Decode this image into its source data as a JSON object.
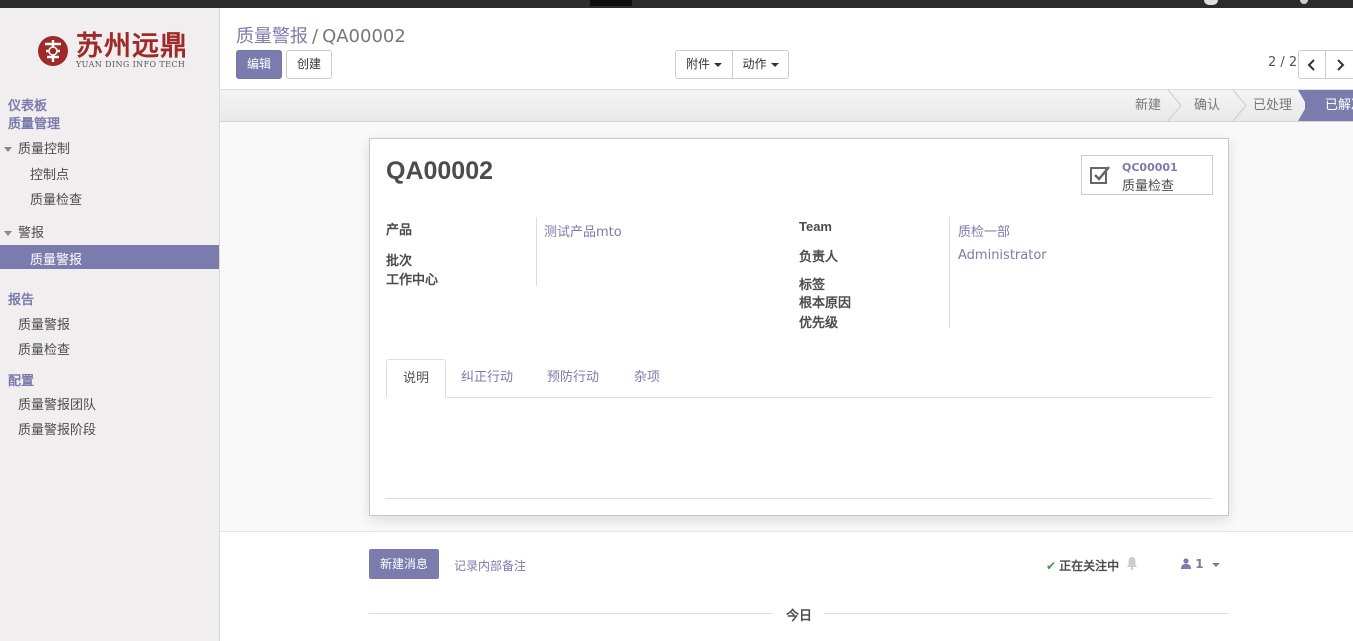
{
  "brand": {
    "name_cn": "苏州远鼎",
    "name_en": "YUAN DING INFO TECH"
  },
  "sidebar": {
    "dashboard": "仪表板",
    "quality_mgmt": "质量管理",
    "group_quality_control": "质量控制",
    "item_control_points": "控制点",
    "item_quality_checks": "质量检查",
    "group_alerts": "警报",
    "item_quality_alerts_active": "质量警报",
    "section_reports": "报告",
    "report_quality_alerts": "质量警报",
    "report_quality_checks": "质量检查",
    "section_config": "配置",
    "config_alert_teams": "质量警报团队",
    "config_alert_stages": "质量警报阶段"
  },
  "breadcrumb": {
    "parent": "质量警报",
    "separator": "/",
    "current": "QA00002"
  },
  "buttons": {
    "edit": "编辑",
    "create": "创建",
    "attachment": "附件",
    "action": "动作"
  },
  "pager": {
    "text": "2 / 2",
    "prev_icon": "chevron-left-icon",
    "next_icon": "chevron-right-icon"
  },
  "statusbar": {
    "stages": [
      "新建",
      "确认",
      "已处理",
      "已解决"
    ],
    "active_index": 3
  },
  "record": {
    "name": "QA00002",
    "smart_button": {
      "value": "QC00001",
      "label": "质量检查",
      "icon": "checkbox-icon"
    },
    "labels": {
      "product": "产品",
      "lot": "批次",
      "workcenter": "工作中心",
      "team": "Team",
      "responsible": "负责人",
      "tags": "标签",
      "root_cause": "根本原因",
      "priority": "优先级"
    },
    "values": {
      "product": "测试产品mto",
      "team": "质检一部",
      "responsible": "Administrator"
    }
  },
  "tabs": [
    "说明",
    "纠正行动",
    "预防行动",
    "杂项"
  ],
  "active_tab": 0,
  "chatter": {
    "new_message": "新建消息",
    "log_note": "记录内部备注",
    "following": "正在关注中",
    "followers_count": "1",
    "today": "今日"
  },
  "colors": {
    "accent": "#7c7bad",
    "brand_red": "#9f2a2a"
  }
}
